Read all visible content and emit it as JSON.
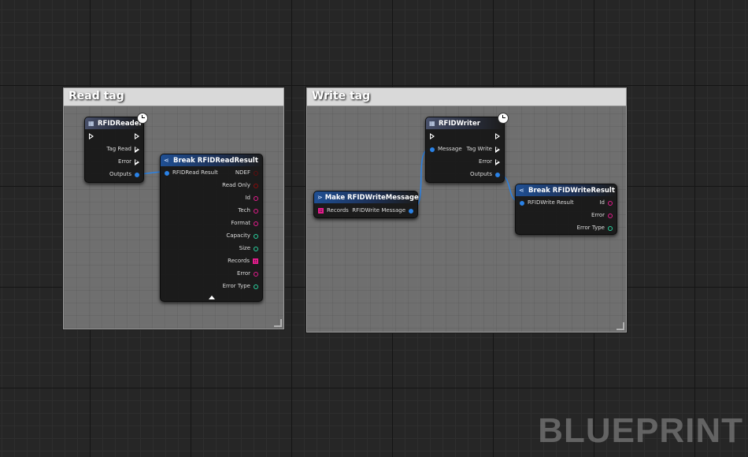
{
  "comments": {
    "read": {
      "title": "Read tag"
    },
    "write": {
      "title": "Write tag"
    }
  },
  "rfid_reader": {
    "title": "RFIDReader",
    "pins": {
      "tag_read": "Tag Read",
      "error": "Error",
      "outputs": "Outputs"
    }
  },
  "break_read": {
    "title": "Break RFIDReadResult",
    "input": "RFIDRead Result",
    "outputs": [
      "NDEF",
      "Read Only",
      "Id",
      "Tech",
      "Format",
      "Capacity",
      "Size",
      "Records",
      "Error",
      "Error Type"
    ]
  },
  "make_write": {
    "title": "Make RFIDWriteMessage",
    "input": "Records",
    "output": "RFIDWrite Message"
  },
  "rfid_writer": {
    "title": "RFIDWriter",
    "input": "Message",
    "pins": {
      "tag_write": "Tag Write",
      "error": "Error",
      "outputs": "Outputs"
    }
  },
  "break_write": {
    "title": "Break RFIDWriteResult",
    "input": "RFIDWrite Result",
    "outputs": [
      "Id",
      "Error",
      "Error Type"
    ]
  },
  "watermark": "BLUEPRINT",
  "colors": {
    "struct_pin": "#2a82e6",
    "string_pin": "#e51c8d",
    "byte_pin": "#2ad3a0",
    "bool_pin": "#8a0c0c",
    "wire": "#2a82e6"
  }
}
